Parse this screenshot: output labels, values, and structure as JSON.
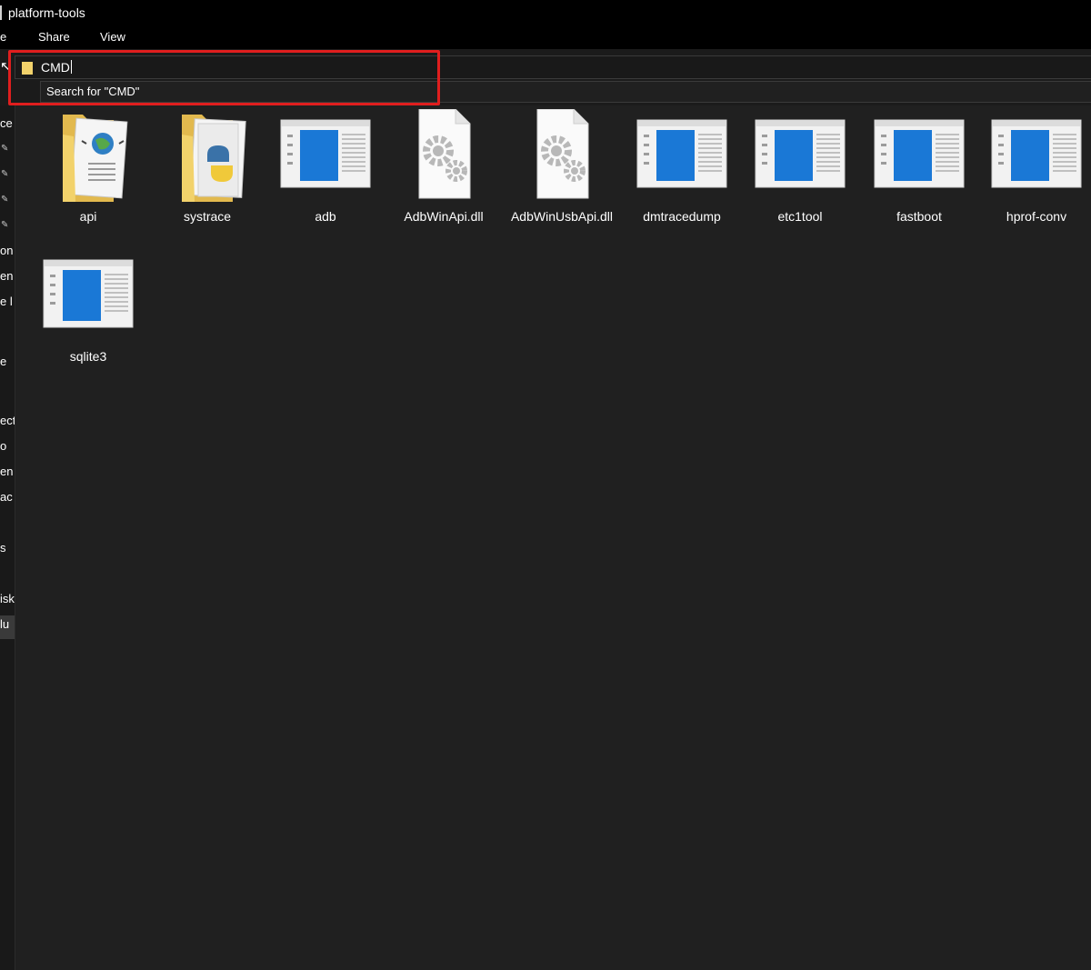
{
  "window": {
    "title": "platform-tools"
  },
  "ribbon": {
    "tabs": [
      "e",
      "Share",
      "View"
    ]
  },
  "address": {
    "value": "CMD",
    "suggestion": "Search for \"CMD\""
  },
  "sidebar": {
    "fragments": [
      "ce",
      "on",
      "en",
      "e l",
      "e",
      "ect",
      "o",
      "en",
      "ac",
      "s",
      "isk",
      "lu"
    ]
  },
  "items": [
    {
      "name": "api",
      "icon": "folder-web-icon"
    },
    {
      "name": "systrace",
      "icon": "folder-python-icon"
    },
    {
      "name": "adb",
      "icon": "app-window-icon"
    },
    {
      "name": "AdbWinApi.dll",
      "icon": "dll-gear-icon"
    },
    {
      "name": "AdbWinUsbApi.dll",
      "icon": "dll-gear-icon"
    },
    {
      "name": "dmtracedump",
      "icon": "app-window-icon"
    },
    {
      "name": "etc1tool",
      "icon": "app-window-icon"
    },
    {
      "name": "fastboot",
      "icon": "app-window-icon"
    },
    {
      "name": "hprof-conv",
      "icon": "app-window-icon"
    },
    {
      "name": "sqlite3",
      "icon": "app-window-icon"
    }
  ],
  "colors": {
    "background": "#202020",
    "highlight": "#e01e1e",
    "accent_blue": "#1a78d6",
    "folder": "#f2d26b"
  }
}
